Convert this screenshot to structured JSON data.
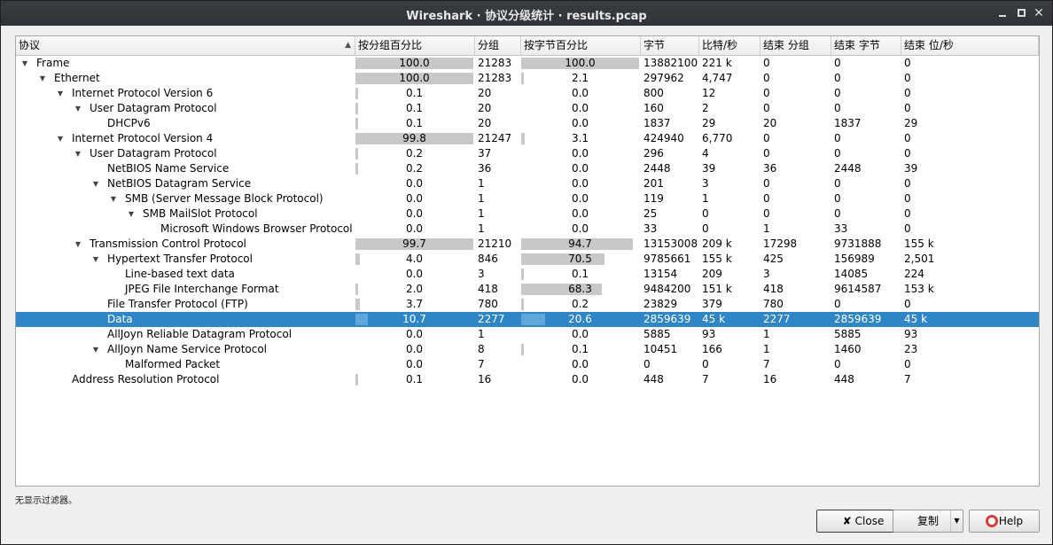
{
  "window": {
    "title": "Wireshark · 协议分级统计 · results.pcap"
  },
  "columns": {
    "protocol": "协议",
    "pct_packets": "按分组百分比",
    "packets": "分组",
    "pct_bytes": "按字节百分比",
    "bytes": "字节",
    "bps": "比特/秒",
    "end_packets": "结束 分组",
    "end_bytes": "结束 字节",
    "end_bps": "结束 位/秒"
  },
  "rows": [
    {
      "name": "Frame",
      "level": 0,
      "expanded": true,
      "pct_packets": "100.0",
      "pct_packets_frac": 1.0,
      "packets": "21283",
      "pct_bytes": "100.0",
      "pct_bytes_frac": 1.0,
      "bytes": "13882100",
      "bps": "221 k",
      "end_packets": "0",
      "end_bytes": "0",
      "end_bps": "0"
    },
    {
      "name": "Ethernet",
      "level": 1,
      "expanded": true,
      "pct_packets": "100.0",
      "pct_packets_frac": 1.0,
      "packets": "21283",
      "pct_bytes": "2.1",
      "pct_bytes_frac": 0.021,
      "bytes": "297962",
      "bps": "4,747",
      "end_packets": "0",
      "end_bytes": "0",
      "end_bps": "0"
    },
    {
      "name": "Internet Protocol Version 6",
      "level": 2,
      "expanded": true,
      "pct_packets": "0.1",
      "pct_packets_frac": 0.001,
      "packets": "20",
      "pct_bytes": "0.0",
      "pct_bytes_frac": 0.0,
      "bytes": "800",
      "bps": "12",
      "end_packets": "0",
      "end_bytes": "0",
      "end_bps": "0"
    },
    {
      "name": "User Datagram Protocol",
      "level": 3,
      "expanded": true,
      "pct_packets": "0.1",
      "pct_packets_frac": 0.001,
      "packets": "20",
      "pct_bytes": "0.0",
      "pct_bytes_frac": 0.0,
      "bytes": "160",
      "bps": "2",
      "end_packets": "0",
      "end_bytes": "0",
      "end_bps": "0"
    },
    {
      "name": "DHCPv6",
      "level": 4,
      "expanded": null,
      "pct_packets": "0.1",
      "pct_packets_frac": 0.001,
      "packets": "20",
      "pct_bytes": "0.0",
      "pct_bytes_frac": 0.0,
      "bytes": "1837",
      "bps": "29",
      "end_packets": "20",
      "end_bytes": "1837",
      "end_bps": "29"
    },
    {
      "name": "Internet Protocol Version 4",
      "level": 2,
      "expanded": true,
      "pct_packets": "99.8",
      "pct_packets_frac": 0.998,
      "packets": "21247",
      "pct_bytes": "3.1",
      "pct_bytes_frac": 0.031,
      "bytes": "424940",
      "bps": "6,770",
      "end_packets": "0",
      "end_bytes": "0",
      "end_bps": "0"
    },
    {
      "name": "User Datagram Protocol",
      "level": 3,
      "expanded": true,
      "pct_packets": "0.2",
      "pct_packets_frac": 0.002,
      "packets": "37",
      "pct_bytes": "0.0",
      "pct_bytes_frac": 0.0,
      "bytes": "296",
      "bps": "4",
      "end_packets": "0",
      "end_bytes": "0",
      "end_bps": "0"
    },
    {
      "name": "NetBIOS Name Service",
      "level": 4,
      "expanded": null,
      "pct_packets": "0.2",
      "pct_packets_frac": 0.002,
      "packets": "36",
      "pct_bytes": "0.0",
      "pct_bytes_frac": 0.0,
      "bytes": "2448",
      "bps": "39",
      "end_packets": "36",
      "end_bytes": "2448",
      "end_bps": "39"
    },
    {
      "name": "NetBIOS Datagram Service",
      "level": 4,
      "expanded": true,
      "pct_packets": "0.0",
      "pct_packets_frac": 0.0,
      "packets": "1",
      "pct_bytes": "0.0",
      "pct_bytes_frac": 0.0,
      "bytes": "201",
      "bps": "3",
      "end_packets": "0",
      "end_bytes": "0",
      "end_bps": "0"
    },
    {
      "name": "SMB (Server Message Block Protocol)",
      "level": 5,
      "expanded": true,
      "pct_packets": "0.0",
      "pct_packets_frac": 0.0,
      "packets": "1",
      "pct_bytes": "0.0",
      "pct_bytes_frac": 0.0,
      "bytes": "119",
      "bps": "1",
      "end_packets": "0",
      "end_bytes": "0",
      "end_bps": "0"
    },
    {
      "name": "SMB MailSlot Protocol",
      "level": 6,
      "expanded": true,
      "pct_packets": "0.0",
      "pct_packets_frac": 0.0,
      "packets": "1",
      "pct_bytes": "0.0",
      "pct_bytes_frac": 0.0,
      "bytes": "25",
      "bps": "0",
      "end_packets": "0",
      "end_bytes": "0",
      "end_bps": "0"
    },
    {
      "name": "Microsoft Windows Browser Protocol",
      "level": 7,
      "expanded": null,
      "pct_packets": "0.0",
      "pct_packets_frac": 0.0,
      "packets": "1",
      "pct_bytes": "0.0",
      "pct_bytes_frac": 0.0,
      "bytes": "33",
      "bps": "0",
      "end_packets": "1",
      "end_bytes": "33",
      "end_bps": "0"
    },
    {
      "name": "Transmission Control Protocol",
      "level": 3,
      "expanded": true,
      "pct_packets": "99.7",
      "pct_packets_frac": 0.997,
      "packets": "21210",
      "pct_bytes": "94.7",
      "pct_bytes_frac": 0.947,
      "bytes": "13153008",
      "bps": "209 k",
      "end_packets": "17298",
      "end_bytes": "9731888",
      "end_bps": "155 k"
    },
    {
      "name": "Hypertext Transfer Protocol",
      "level": 4,
      "expanded": true,
      "pct_packets": "4.0",
      "pct_packets_frac": 0.04,
      "packets": "846",
      "pct_bytes": "70.5",
      "pct_bytes_frac": 0.705,
      "bytes": "9785661",
      "bps": "155 k",
      "end_packets": "425",
      "end_bytes": "156989",
      "end_bps": "2,501"
    },
    {
      "name": "Line-based text data",
      "level": 5,
      "expanded": null,
      "pct_packets": "0.0",
      "pct_packets_frac": 0.0,
      "packets": "3",
      "pct_bytes": "0.1",
      "pct_bytes_frac": 0.001,
      "bytes": "13154",
      "bps": "209",
      "end_packets": "3",
      "end_bytes": "14085",
      "end_bps": "224"
    },
    {
      "name": "JPEG File Interchange Format",
      "level": 5,
      "expanded": null,
      "pct_packets": "2.0",
      "pct_packets_frac": 0.02,
      "packets": "418",
      "pct_bytes": "68.3",
      "pct_bytes_frac": 0.683,
      "bytes": "9484200",
      "bps": "151 k",
      "end_packets": "418",
      "end_bytes": "9614587",
      "end_bps": "153 k"
    },
    {
      "name": "File Transfer Protocol (FTP)",
      "level": 4,
      "expanded": null,
      "pct_packets": "3.7",
      "pct_packets_frac": 0.037,
      "packets": "780",
      "pct_bytes": "0.2",
      "pct_bytes_frac": 0.002,
      "bytes": "23829",
      "bps": "379",
      "end_packets": "780",
      "end_bytes": "0",
      "end_bps": "0"
    },
    {
      "name": "Data",
      "level": 4,
      "expanded": null,
      "selected": true,
      "pct_packets": "10.7",
      "pct_packets_frac": 0.107,
      "packets": "2277",
      "pct_bytes": "20.6",
      "pct_bytes_frac": 0.206,
      "bytes": "2859639",
      "bps": "45 k",
      "end_packets": "2277",
      "end_bytes": "2859639",
      "end_bps": "45 k"
    },
    {
      "name": "AllJoyn Reliable Datagram Protocol",
      "level": 4,
      "expanded": null,
      "pct_packets": "0.0",
      "pct_packets_frac": 0.0,
      "packets": "1",
      "pct_bytes": "0.0",
      "pct_bytes_frac": 0.0,
      "bytes": "5885",
      "bps": "93",
      "end_packets": "1",
      "end_bytes": "5885",
      "end_bps": "93"
    },
    {
      "name": "AllJoyn Name Service Protocol",
      "level": 4,
      "expanded": true,
      "pct_packets": "0.0",
      "pct_packets_frac": 0.0,
      "packets": "8",
      "pct_bytes": "0.1",
      "pct_bytes_frac": 0.001,
      "bytes": "10451",
      "bps": "166",
      "end_packets": "1",
      "end_bytes": "1460",
      "end_bps": "23"
    },
    {
      "name": "Malformed Packet",
      "level": 5,
      "expanded": null,
      "pct_packets": "0.0",
      "pct_packets_frac": 0.0,
      "packets": "7",
      "pct_bytes": "0.0",
      "pct_bytes_frac": 0.0,
      "bytes": "0",
      "bps": "0",
      "end_packets": "7",
      "end_bytes": "0",
      "end_bps": "0"
    },
    {
      "name": "Address Resolution Protocol",
      "level": 2,
      "expanded": null,
      "pct_packets": "0.1",
      "pct_packets_frac": 0.001,
      "packets": "16",
      "pct_bytes": "0.0",
      "pct_bytes_frac": 0.0,
      "bytes": "448",
      "bps": "7",
      "end_packets": "16",
      "end_bytes": "448",
      "end_bps": "7"
    }
  ],
  "status": {
    "filter_text": "无显示过滤器。"
  },
  "buttons": {
    "close_label": "Close",
    "copy_label": "复制",
    "help_label": "Help"
  },
  "icons": {
    "close_button_icon": "close-x-icon",
    "help_button_icon": "lifebuoy-icon",
    "sort_indicator": "sort-ascending-icon"
  },
  "colors": {
    "selection": "#2f86c7",
    "bar": "#c8c8c8",
    "selected_bar": "#5fa6da"
  }
}
